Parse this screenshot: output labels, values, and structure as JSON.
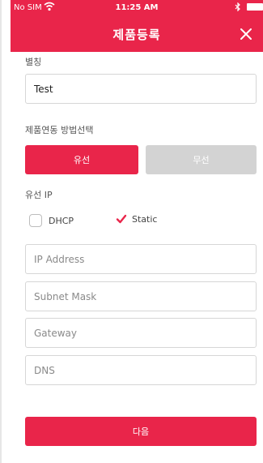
{
  "status": {
    "carrier": "No SIM",
    "time": "11:25 AM"
  },
  "header": {
    "title": "제품등록"
  },
  "nickname": {
    "label": "별칭",
    "value": "Test"
  },
  "link_method": {
    "label": "제품연동 방법선택",
    "wired": "유선",
    "wireless": "무선",
    "selected": "wired"
  },
  "wired_ip": {
    "label": "유선 IP",
    "dhcp": {
      "label": "DHCP",
      "checked": false
    },
    "static": {
      "label": "Static",
      "checked": true
    },
    "fields": {
      "ip_address": "IP Address",
      "subnet_mask": "Subnet Mask",
      "gateway": "Gateway",
      "dns": "DNS"
    }
  },
  "next_button": "다음",
  "colors": {
    "primary": "#e9254a",
    "inactive": "#d3d3d3",
    "border": "#d6d6d6"
  },
  "icons": [
    "wifi-icon",
    "bluetooth-icon",
    "battery-icon",
    "close-icon",
    "check-icon"
  ]
}
